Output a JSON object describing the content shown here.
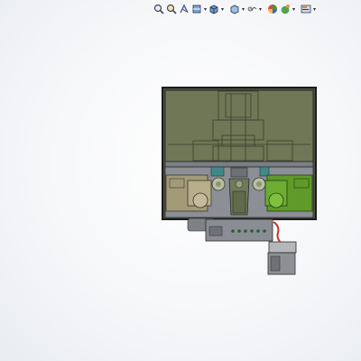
{
  "toolbar": {
    "buttons": [
      {
        "name": "zoom-to-fit-icon",
        "has_dropdown": false
      },
      {
        "name": "zoom-to-area-icon",
        "has_dropdown": false
      },
      {
        "name": "previous-view-icon",
        "has_dropdown": false
      },
      {
        "name": "section-view-icon",
        "has_dropdown": false
      },
      {
        "name": "view-orientation-icon",
        "has_dropdown": true
      },
      {
        "name": "display-style-icon",
        "has_dropdown": true
      },
      {
        "name": "hide-show-items-icon",
        "has_dropdown": true
      },
      {
        "name": "edit-appearance-icon",
        "has_dropdown": false
      },
      {
        "name": "apply-scene-icon",
        "has_dropdown": true
      },
      {
        "name": "view-settings-icon",
        "has_dropdown": true
      }
    ]
  },
  "colors": {
    "housing_fill": "#6f7756",
    "housing_stroke": "#1b1b1b",
    "tray_fill": "#8c8f96",
    "left_part": "#a39a78",
    "right_part": "#5f9a2b",
    "teal_part": "#3f8a88",
    "connector": "#8a8d93",
    "wire": "#c0392b",
    "module": "#8e9094"
  }
}
